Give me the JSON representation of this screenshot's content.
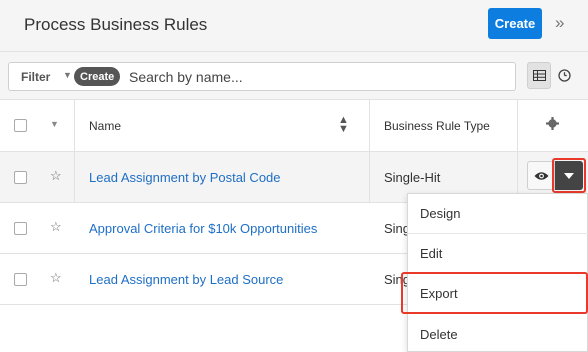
{
  "header": {
    "title": "Process Business Rules",
    "create_label": "Create",
    "expand_icon": "double-chevron-right-icon"
  },
  "filter": {
    "filter_label": "Filter",
    "create_label": "Create",
    "search_placeholder": "Search by name..."
  },
  "table": {
    "columns": [
      "Name",
      "Business Rule Type"
    ],
    "rows": [
      {
        "name": "Lead Assignment by Postal Code",
        "type": "Single-Hit"
      },
      {
        "name": "Approval Criteria for $10k Opportunities",
        "type": "Sing"
      },
      {
        "name": "Lead Assignment by Lead Source",
        "type": "Sing"
      }
    ]
  },
  "menu": {
    "items": [
      "Design",
      "Edit",
      "Export",
      "Delete"
    ]
  },
  "colors": {
    "accent": "#0d7ee0",
    "link": "#1f6fc5",
    "highlight": "#e8392b"
  }
}
